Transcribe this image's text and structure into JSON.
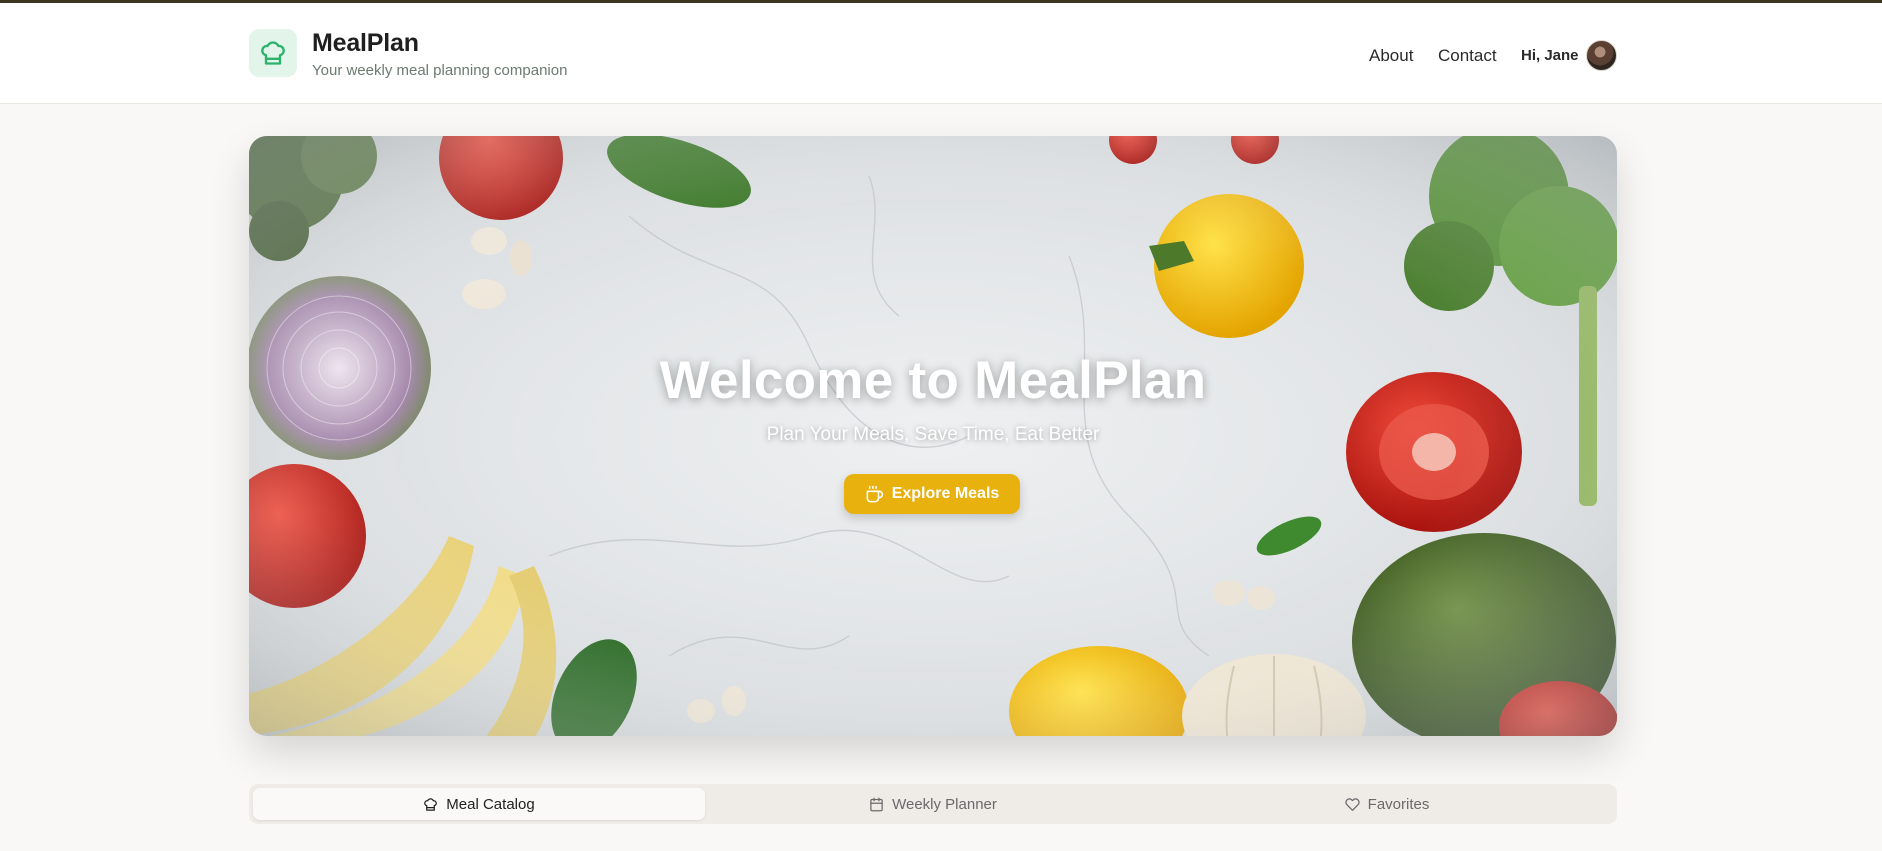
{
  "header": {
    "brand_title": "MealPlan",
    "brand_subtitle": "Your weekly meal planning companion",
    "nav": [
      {
        "label": "About"
      },
      {
        "label": "Contact"
      }
    ],
    "greeting": "Hi, Jane",
    "logo_icon": "chef-hat-icon",
    "avatar": "user-avatar"
  },
  "hero": {
    "title": "Welcome to MealPlan",
    "subtitle": "Plan Your Meals, Save Time, Eat Better",
    "cta_label": "Explore Meals",
    "cta_icon": "coffee-cup-icon"
  },
  "tabs": [
    {
      "label": "Meal Catalog",
      "icon": "chef-hat-icon",
      "active": true
    },
    {
      "label": "Weekly Planner",
      "icon": "calendar-icon",
      "active": false
    },
    {
      "label": "Favorites",
      "icon": "heart-icon",
      "active": false
    }
  ],
  "colors": {
    "accent_yellow": "#e9b10d",
    "logo_bg": "#e3f4ea",
    "logo_green": "#2bb36b",
    "page_bg": "#f9f8f6"
  }
}
